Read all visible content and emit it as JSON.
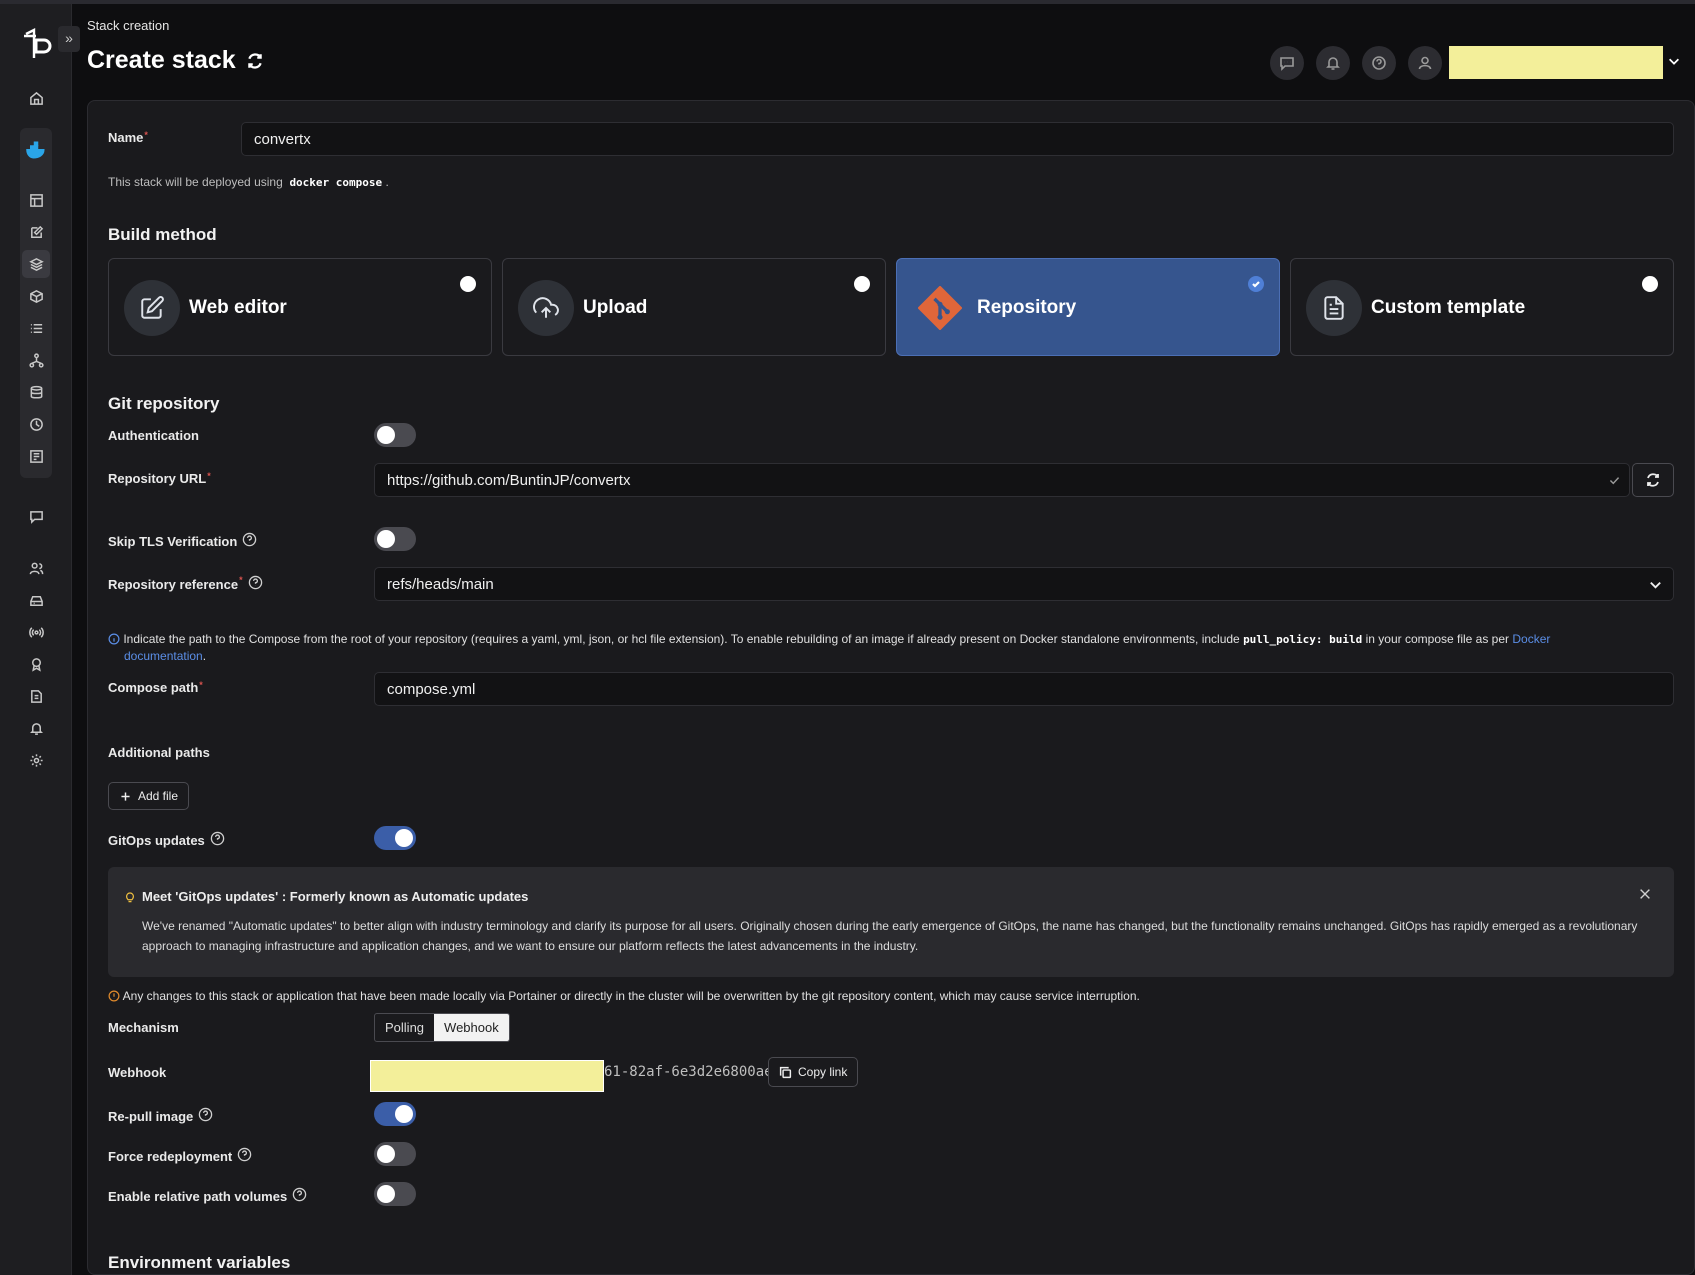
{
  "header": {
    "breadcrumb": "Stack creation",
    "title": "Create stack"
  },
  "form": {
    "name_label": "Name",
    "name_value": "convertx",
    "deploy_note_prefix": "This stack will be deployed using",
    "deploy_note_code": "docker compose",
    "deploy_note_suffix": "."
  },
  "build_method": {
    "title": "Build method",
    "options": [
      {
        "label": "Web editor",
        "icon": "edit-icon",
        "selected": false
      },
      {
        "label": "Upload",
        "icon": "upload-icon",
        "selected": false
      },
      {
        "label": "Repository",
        "icon": "git-icon",
        "selected": true
      },
      {
        "label": "Custom template",
        "icon": "document-icon",
        "selected": false
      }
    ]
  },
  "git": {
    "title": "Git repository",
    "auth_label": "Authentication",
    "url_label": "Repository URL",
    "url_value": "https://github.com/BuntinJP/convertx",
    "skip_tls_label": "Skip TLS Verification",
    "ref_label": "Repository reference",
    "ref_value": "refs/heads/main",
    "compose_info_1": "Indicate the path to the Compose from the root of your repository (requires a yaml, yml, json, or hcl file extension).  To enable rebuilding of an image if already present on Docker standalone environments, include",
    "compose_info_code": "pull_policy: build",
    "compose_info_2": "in your compose file as per",
    "compose_info_link_1": "Docker",
    "compose_info_link_2": "documentation",
    "compose_info_end": ".",
    "compose_label": "Compose path",
    "compose_value": "compose.yml",
    "additional_paths_label": "Additional paths",
    "add_file_label": "Add file",
    "gitops_label": "GitOps updates"
  },
  "alert": {
    "title": "Meet 'GitOps updates' : Formerly known as Automatic updates",
    "text": "We've renamed \"Automatic updates\" to better align with industry terminology and clarify its purpose for all users. Originally chosen during the early emergence of GitOps, the name has changed, but the functionality remains unchanged. GitOps has rapidly emerged as a revolutionary approach to managing infrastructure and application changes, and we want to ensure our platform reflects the latest advancements in the industry."
  },
  "warning": "Any changes to this stack or application that have been made locally via Portainer or directly in the cluster will be overwritten by the git repository content, which may cause service interruption.",
  "mechanism": {
    "label": "Mechanism",
    "options": [
      "Polling",
      "Webhook"
    ],
    "selected": "Webhook"
  },
  "webhook": {
    "label": "Webhook",
    "visible_suffix": "61-82af-6e3d2e6800ae",
    "copy_label": "Copy link"
  },
  "options": {
    "repull_label": "Re-pull image",
    "repull_on": true,
    "force_label": "Force redeployment",
    "force_on": false,
    "relative_label": "Enable relative path volumes",
    "relative_on": false
  },
  "env_title": "Environment variables",
  "colors": {
    "accent": "#3b5ea8",
    "selected_card": "#36558e",
    "redacted": "#f3ef9a",
    "required": "#d9534f",
    "link": "#5b8ee6"
  }
}
